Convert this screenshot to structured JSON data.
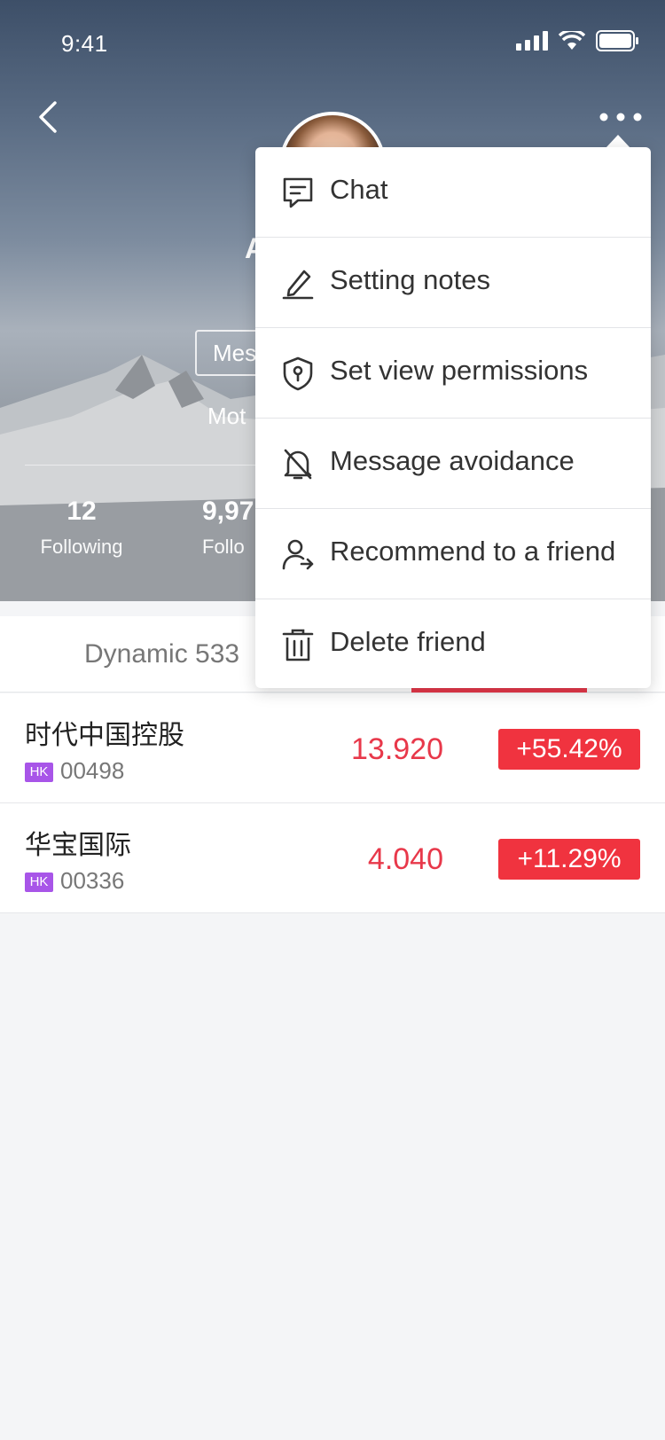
{
  "status_bar": {
    "time": "9:41"
  },
  "profile": {
    "name_fragment": "A",
    "message_button_fragment": "Mes",
    "motto_fragment": "Mot",
    "stats": [
      {
        "value": "12",
        "label": "Following"
      },
      {
        "value": "9,97",
        "label": "Follo"
      }
    ]
  },
  "tabs": {
    "dynamic_label": "Dynamic 533"
  },
  "stocks": [
    {
      "name": "时代中国控股",
      "market": "HK",
      "code": "00498",
      "price": "13.920",
      "change": "+55.42%"
    },
    {
      "name": "华宝国际",
      "market": "HK",
      "code": "00336",
      "price": "4.040",
      "change": "+11.29%"
    }
  ],
  "menu": {
    "items": [
      {
        "label": "Chat",
        "icon": "chat-icon"
      },
      {
        "label": "Setting notes",
        "icon": "pencil-icon"
      },
      {
        "label": "Set view permissions",
        "icon": "shield-icon"
      },
      {
        "label": "Message avoidance",
        "icon": "bell-off-icon"
      },
      {
        "label": "Recommend to a friend",
        "icon": "user-share-icon"
      },
      {
        "label": "Delete friend",
        "icon": "trash-icon"
      }
    ]
  },
  "colors": {
    "accent_red": "#e8384a",
    "change_bg": "#f0333f",
    "hk_badge": "#a855e8"
  }
}
